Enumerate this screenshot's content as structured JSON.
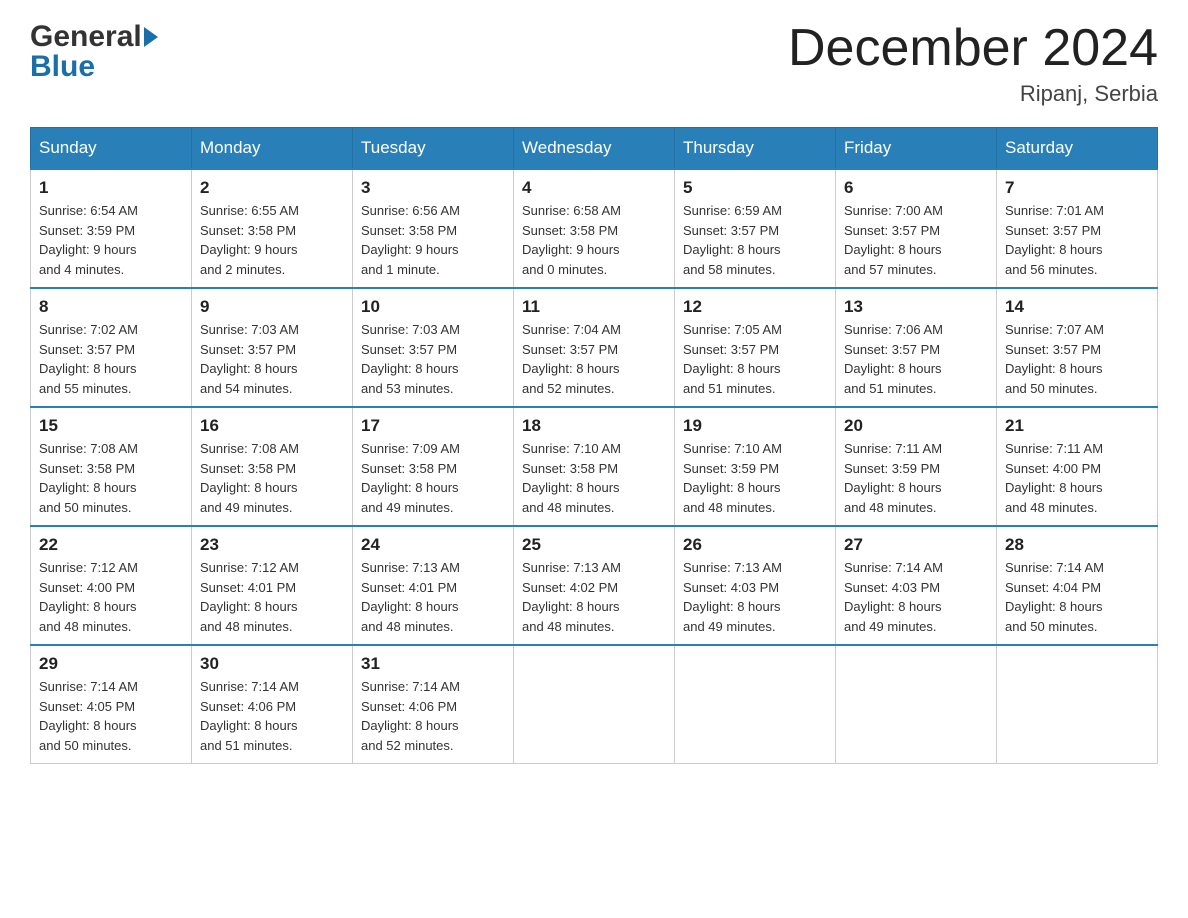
{
  "header": {
    "logo_general": "General",
    "logo_blue": "Blue",
    "month_title": "December 2024",
    "location": "Ripanj, Serbia"
  },
  "days_of_week": [
    "Sunday",
    "Monday",
    "Tuesday",
    "Wednesday",
    "Thursday",
    "Friday",
    "Saturday"
  ],
  "weeks": [
    [
      {
        "day": "1",
        "sunrise": "6:54 AM",
        "sunset": "3:59 PM",
        "daylight": "9 hours and 4 minutes."
      },
      {
        "day": "2",
        "sunrise": "6:55 AM",
        "sunset": "3:58 PM",
        "daylight": "9 hours and 2 minutes."
      },
      {
        "day": "3",
        "sunrise": "6:56 AM",
        "sunset": "3:58 PM",
        "daylight": "9 hours and 1 minute."
      },
      {
        "day": "4",
        "sunrise": "6:58 AM",
        "sunset": "3:58 PM",
        "daylight": "9 hours and 0 minutes."
      },
      {
        "day": "5",
        "sunrise": "6:59 AM",
        "sunset": "3:57 PM",
        "daylight": "8 hours and 58 minutes."
      },
      {
        "day": "6",
        "sunrise": "7:00 AM",
        "sunset": "3:57 PM",
        "daylight": "8 hours and 57 minutes."
      },
      {
        "day": "7",
        "sunrise": "7:01 AM",
        "sunset": "3:57 PM",
        "daylight": "8 hours and 56 minutes."
      }
    ],
    [
      {
        "day": "8",
        "sunrise": "7:02 AM",
        "sunset": "3:57 PM",
        "daylight": "8 hours and 55 minutes."
      },
      {
        "day": "9",
        "sunrise": "7:03 AM",
        "sunset": "3:57 PM",
        "daylight": "8 hours and 54 minutes."
      },
      {
        "day": "10",
        "sunrise": "7:03 AM",
        "sunset": "3:57 PM",
        "daylight": "8 hours and 53 minutes."
      },
      {
        "day": "11",
        "sunrise": "7:04 AM",
        "sunset": "3:57 PM",
        "daylight": "8 hours and 52 minutes."
      },
      {
        "day": "12",
        "sunrise": "7:05 AM",
        "sunset": "3:57 PM",
        "daylight": "8 hours and 51 minutes."
      },
      {
        "day": "13",
        "sunrise": "7:06 AM",
        "sunset": "3:57 PM",
        "daylight": "8 hours and 51 minutes."
      },
      {
        "day": "14",
        "sunrise": "7:07 AM",
        "sunset": "3:57 PM",
        "daylight": "8 hours and 50 minutes."
      }
    ],
    [
      {
        "day": "15",
        "sunrise": "7:08 AM",
        "sunset": "3:58 PM",
        "daylight": "8 hours and 50 minutes."
      },
      {
        "day": "16",
        "sunrise": "7:08 AM",
        "sunset": "3:58 PM",
        "daylight": "8 hours and 49 minutes."
      },
      {
        "day": "17",
        "sunrise": "7:09 AM",
        "sunset": "3:58 PM",
        "daylight": "8 hours and 49 minutes."
      },
      {
        "day": "18",
        "sunrise": "7:10 AM",
        "sunset": "3:58 PM",
        "daylight": "8 hours and 48 minutes."
      },
      {
        "day": "19",
        "sunrise": "7:10 AM",
        "sunset": "3:59 PM",
        "daylight": "8 hours and 48 minutes."
      },
      {
        "day": "20",
        "sunrise": "7:11 AM",
        "sunset": "3:59 PM",
        "daylight": "8 hours and 48 minutes."
      },
      {
        "day": "21",
        "sunrise": "7:11 AM",
        "sunset": "4:00 PM",
        "daylight": "8 hours and 48 minutes."
      }
    ],
    [
      {
        "day": "22",
        "sunrise": "7:12 AM",
        "sunset": "4:00 PM",
        "daylight": "8 hours and 48 minutes."
      },
      {
        "day": "23",
        "sunrise": "7:12 AM",
        "sunset": "4:01 PM",
        "daylight": "8 hours and 48 minutes."
      },
      {
        "day": "24",
        "sunrise": "7:13 AM",
        "sunset": "4:01 PM",
        "daylight": "8 hours and 48 minutes."
      },
      {
        "day": "25",
        "sunrise": "7:13 AM",
        "sunset": "4:02 PM",
        "daylight": "8 hours and 48 minutes."
      },
      {
        "day": "26",
        "sunrise": "7:13 AM",
        "sunset": "4:03 PM",
        "daylight": "8 hours and 49 minutes."
      },
      {
        "day": "27",
        "sunrise": "7:14 AM",
        "sunset": "4:03 PM",
        "daylight": "8 hours and 49 minutes."
      },
      {
        "day": "28",
        "sunrise": "7:14 AM",
        "sunset": "4:04 PM",
        "daylight": "8 hours and 50 minutes."
      }
    ],
    [
      {
        "day": "29",
        "sunrise": "7:14 AM",
        "sunset": "4:05 PM",
        "daylight": "8 hours and 50 minutes."
      },
      {
        "day": "30",
        "sunrise": "7:14 AM",
        "sunset": "4:06 PM",
        "daylight": "8 hours and 51 minutes."
      },
      {
        "day": "31",
        "sunrise": "7:14 AM",
        "sunset": "4:06 PM",
        "daylight": "8 hours and 52 minutes."
      },
      null,
      null,
      null,
      null
    ]
  ],
  "labels": {
    "sunrise": "Sunrise:",
    "sunset": "Sunset:",
    "daylight": "Daylight:"
  }
}
